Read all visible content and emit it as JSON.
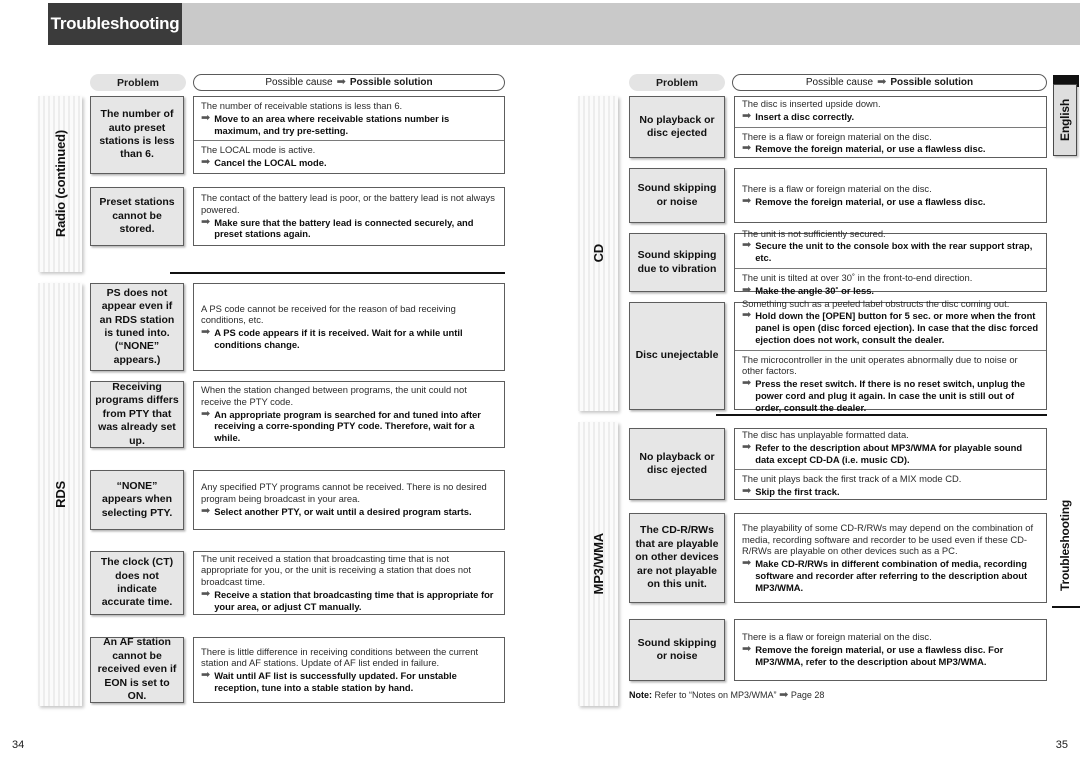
{
  "header": {
    "title": "Troubleshooting"
  },
  "captions": {
    "problem": "Problem",
    "cause_lead": "Possible cause",
    "arrow": "➡",
    "cause_solution": "Possible solution"
  },
  "left_page": {
    "page_number": "34",
    "sections": [
      {
        "tab_label": "Radio (continued)",
        "rows": [
          {
            "problem": "The number of auto preset stations is less than 6.",
            "items": [
              {
                "cause": "The number of receivable stations is less than 6.",
                "fix": "Move to an area where receivable stations number is maximum, and try pre-setting."
              },
              {
                "cause": "The LOCAL mode is active.",
                "fix": "Cancel the LOCAL mode."
              }
            ]
          },
          {
            "problem": "Preset stations cannot be stored.",
            "items": [
              {
                "cause": "The contact of the battery lead is poor, or the battery lead is not always powered.",
                "fix": "Make sure that the battery lead is connected securely, and preset stations again."
              }
            ]
          }
        ]
      },
      {
        "tab_label": "RDS",
        "rows": [
          {
            "problem": "PS does not appear even if an RDS station is tuned into. (“NONE” appears.)",
            "items": [
              {
                "cause": "A PS code cannot be received for the reason of bad receiving conditions, etc.",
                "fix": "A PS code appears if it is received. Wait for a while until conditions change."
              }
            ]
          },
          {
            "problem": "Receiving programs differs from PTY that was already set up.",
            "items": [
              {
                "cause": "When the station changed between programs, the unit could not receive the PTY code.",
                "fix": "An appropriate program is searched for and tuned into after receiving a corre-sponding PTY code. Therefore, wait for a while."
              }
            ]
          },
          {
            "problem": "“NONE” appears when selecting PTY.",
            "items": [
              {
                "cause": "Any specified PTY programs cannot be received. There is no desired program being broadcast in your area.",
                "fix": "Select another PTY, or wait until a desired program starts."
              }
            ]
          },
          {
            "problem": "The clock (CT) does not indicate accurate time.",
            "items": [
              {
                "cause": "The unit received a station that broadcasting time that is not appropriate for you, or the unit is receiving a station that does not broadcast time.",
                "fix": "Receive a station that broadcasting time that is appropriate for your area, or adjust CT manually."
              }
            ]
          },
          {
            "problem": "An AF station cannot be received even if EON is set to ON.",
            "items": [
              {
                "cause": "There is little difference in receiving conditions between the current station and AF stations. Update of AF list ended in failure.",
                "fix": "Wait until AF list is successfully updated. For unstable reception, tune into a stable station by hand."
              }
            ]
          }
        ]
      }
    ]
  },
  "right_page": {
    "page_number": "35",
    "note": {
      "label": "Note:",
      "text": "Refer to “Notes on MP3/WMA”",
      "arrow": "➡",
      "page_ref": "Page 28"
    },
    "index_tabs": [
      {
        "label": "English",
        "style": "boxed"
      },
      {
        "label": "Troubleshooting",
        "style": "plain"
      }
    ],
    "sections": [
      {
        "tab_label": "CD",
        "rows": [
          {
            "problem": "No playback or disc ejected",
            "items": [
              {
                "cause": "The disc is inserted upside down.",
                "fix": "Insert a disc correctly."
              },
              {
                "cause": "There is a flaw or foreign material on the disc.",
                "fix": "Remove the foreign material, or use a flawless disc."
              }
            ]
          },
          {
            "problem": "Sound skipping or noise",
            "items": [
              {
                "cause": "There is a flaw or foreign material on the disc.",
                "fix": "Remove the foreign material, or use a flawless disc."
              }
            ]
          },
          {
            "problem": "Sound skipping due to vibration",
            "items": [
              {
                "cause": "The unit is not sufficiently secured.",
                "fix": "Secure the unit to the console box with the rear support strap, etc."
              },
              {
                "cause": "The unit is tilted at over 30˚ in the front-to-end direction.",
                "fix": "Make the angle 30˚ or less."
              }
            ]
          },
          {
            "problem": "Disc unejectable",
            "items": [
              {
                "cause": "Something such as a peeled label obstructs the disc coming out.",
                "fix": "Hold down the [OPEN] button for 5 sec. or more when the front panel is open (disc forced ejection). In case that the disc forced ejection does not work, consult the dealer."
              },
              {
                "cause": "The microcontroller in the unit operates abnormally due to noise or other factors.",
                "fix": "Press the reset switch. If there is no reset switch, unplug the power cord and plug it again. In case the unit is still out of order, consult the dealer."
              }
            ]
          }
        ]
      },
      {
        "tab_label": "MP3/WMA",
        "rows": [
          {
            "problem": "No playback or disc ejected",
            "items": [
              {
                "cause": "The disc has unplayable formatted data.",
                "fix": "Refer to the description about MP3/WMA for playable sound data except CD-DA (i.e. music CD)."
              },
              {
                "cause": "The unit plays back the first track of a MIX mode CD.",
                "fix": "Skip the first track."
              }
            ]
          },
          {
            "problem": "The CD-R/RWs that are playable on other devices are not playable on this unit.",
            "items": [
              {
                "cause": "The playability of some CD-R/RWs may depend on the combination of media, recording software and recorder to be used even if these CD-R/RWs are playable on other devices such as a PC.",
                "fix": "Make CD-R/RWs in different combination of media, recording software and recorder after referring to the description about MP3/WMA."
              }
            ]
          },
          {
            "problem": "Sound skipping or noise",
            "items": [
              {
                "cause": "There is a flaw or foreign material on the disc.",
                "fix": "Remove the foreign material, or use a flawless disc. For MP3/WMA, refer to the description about MP3/WMA."
              }
            ]
          }
        ]
      }
    ]
  },
  "colors": {
    "header_band": "#c9c9c9",
    "header_title_bg": "#3b3b3b",
    "problem_cell_bg": "#e6e6e6",
    "tab_stripe": "#ededed",
    "rule": "#111111"
  }
}
